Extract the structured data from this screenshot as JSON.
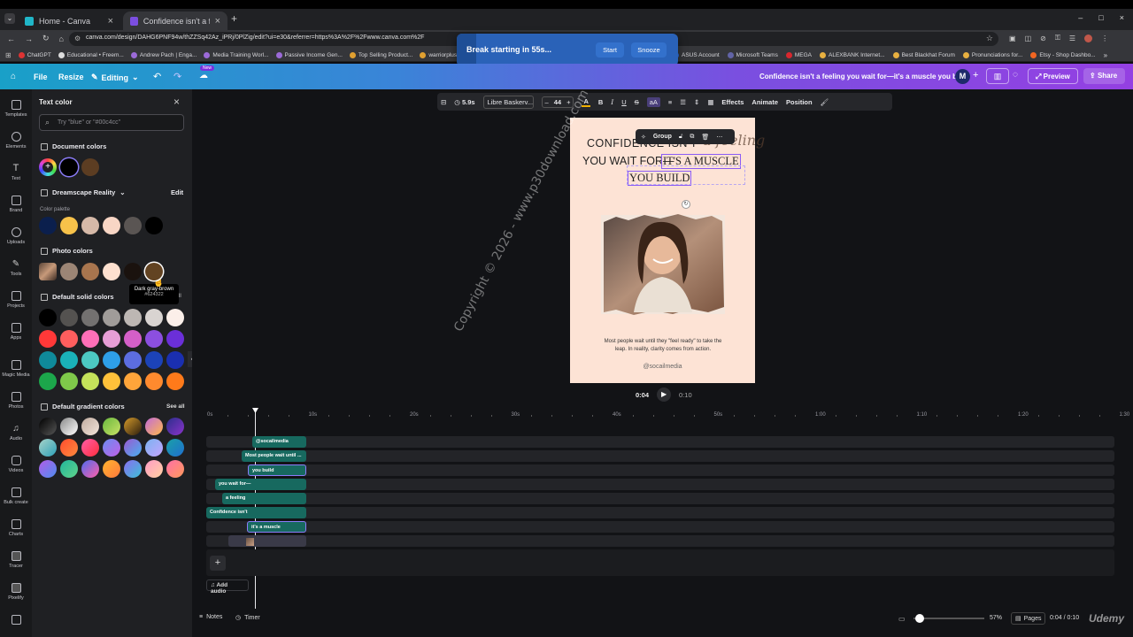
{
  "browser": {
    "tabs": [
      {
        "title": "Home - Canva",
        "active": false
      },
      {
        "title": "Confidence isn't a feeling you w",
        "active": true
      }
    ],
    "url": "canva.com/design/DAHG6PNF94w/thZZSq42Az_iPRj/0PlZig/edit?ui=e30&referrer=https%3A%2F%2Fwww.canva.com%2F",
    "bookmarks": [
      "ChatGPT",
      "Educational • Freem...",
      "Andrew Pach | Enga...",
      "Media Training Worl...",
      "Passive Income Gen...",
      "Top Selling Product...",
      "warriorplus.co",
      "ASUS Account",
      "Microsoft Teams",
      "MEGA",
      "ALEXBANK Internet...",
      "Best Blackhat Forum",
      "Pronunciations for...",
      "Etsy - Shop Dashbo..."
    ]
  },
  "toast": {
    "message": "Break starting in 55s...",
    "start": "Start",
    "snooze": "Snooze"
  },
  "header": {
    "file": "File",
    "resize": "Resize",
    "editing": "Editing",
    "new_badge": "New",
    "doc_title": "Confidence isn't a feeling you wait for—it's a muscle you bui...",
    "avatar": "M",
    "preview": "Preview",
    "share": "Share"
  },
  "rail": [
    "Templates",
    "Elements",
    "Text",
    "Brand",
    "Uploads",
    "Tools",
    "Projects",
    "Apps",
    "Magic Media",
    "Photos",
    "Audio",
    "Videos",
    "Bulk create",
    "Charts",
    "Tracer",
    "Pixelify"
  ],
  "panel": {
    "title": "Text color",
    "search_placeholder": "Try \"blue\" or \"#00c4cc\"",
    "document_colors": "Document colors",
    "brand_kit": "Dreamscape Reality",
    "edit": "Edit",
    "color_palette": "Color palette",
    "photo_colors": "Photo colors",
    "default_solid": "Default solid colors",
    "default_gradient": "Default gradient colors",
    "see_all": "See all",
    "tooltip_name": "Dark gray-brown",
    "tooltip_hex": "#624322",
    "tooltip_suffix": "ll"
  },
  "colors": {
    "doc": [
      "#000000",
      "#5c3d22"
    ],
    "palette": [
      "#0b1f4d",
      "#f7c24a",
      "#d6b9a8",
      "#f8d6c5",
      "#5a5553",
      "#000000"
    ],
    "photo": [
      "#9c8575",
      "#a8754e",
      "#fde0cf",
      "#1a120e",
      "#624322"
    ],
    "solid": [
      [
        "#000000",
        "#545250",
        "#737170",
        "#a09c99",
        "#bdb7b3",
        "#d9d4d1",
        "#fbefe9"
      ],
      [
        "#ff3838",
        "#ff5e5e",
        "#ff6fb8",
        "#e79ed6",
        "#d45fc8",
        "#8c4fe0",
        "#6b2fd8"
      ],
      [
        "#0f8a9a",
        "#1ab2b8",
        "#4cc9c2",
        "#2e9fe8",
        "#5c6de0",
        "#1c43b8",
        "#1a2fb0"
      ],
      [
        "#1ca64b",
        "#7fc94a",
        "#c4e25a",
        "#ffc13a",
        "#ffa53a",
        "#ff8a2e",
        "#ff7a1a"
      ]
    ],
    "gradient": [
      [
        "#000000",
        "#8a8a8a",
        "#c0aca0",
        "#69b83f",
        "#d49a2a",
        "#c26bd8",
        "#2c2f8c"
      ],
      [
        "#a7d3c9",
        "#ff4d2e",
        "#ff5ea8",
        "#6a8df0",
        "#9b59d0",
        "#7bb3f0",
        "#1aa0a6"
      ],
      [
        "#b25ce8",
        "#22b59c",
        "#4d6cf0",
        "#ffb32e",
        "#8a6df0",
        "#ff9cc6",
        "#ff6fa8"
      ]
    ],
    "gradient_to": [
      [
        "#555555",
        "#ffffff",
        "#f3e5db",
        "#c9e265",
        "#2b1d0e",
        "#ffb84d",
        "#8a33c9"
      ],
      [
        "#2ea1b8",
        "#ff8a3d",
        "#ff2e3d",
        "#c060e8",
        "#48b0f0",
        "#c4a5ff",
        "#1f6fd0"
      ],
      [
        "#4e8df0",
        "#5fd38a",
        "#ff5ea8",
        "#ff7a3d",
        "#3cc0d6",
        "#ffd1a1",
        "#ff9a5a"
      ]
    ]
  },
  "toolbar": {
    "duration": "5.9s",
    "font": "Libre Baskerv...",
    "size": "44",
    "effects": "Effects",
    "animate": "Animate",
    "position": "Position"
  },
  "floating": {
    "group": "Group"
  },
  "design": {
    "line1": "CONFIDENCE ISN'T",
    "line1_script": "a feeling",
    "line2": "YOU WAIT FOR—",
    "line2_sel": "IT'S A MUSCLE",
    "line3": "YOU BUILD",
    "body": "Most people wait until they \"feel ready\" to take the leap. In reality, clarity comes from action.",
    "handle": "@socailmedia"
  },
  "player": {
    "current": "0:04",
    "total": "0:10"
  },
  "timeline": {
    "ticks": [
      "0s",
      "10s",
      "20s",
      "30s",
      "40s",
      "50s",
      "1:00",
      "1:10",
      "1:20",
      "1:30"
    ],
    "clips": [
      "@socailmedia",
      "Most people wait until ...",
      "you build",
      "you wait for—",
      "a feeling",
      "Confidence isn't",
      "it's a muscle"
    ],
    "add_audio": "Add audio"
  },
  "footer": {
    "notes": "Notes",
    "timer": "Timer",
    "zoom": "57%",
    "pages": "Pages",
    "time": "0:04 / 0:10"
  },
  "watermark": "Copyright © 2026 - www.p30download.com",
  "udemy": "Udemy"
}
